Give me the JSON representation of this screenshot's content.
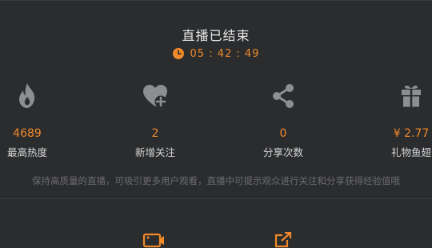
{
  "header": {
    "title": "直播已结束",
    "duration": "05 : 42 : 49"
  },
  "stats": [
    {
      "icon": "flame-icon",
      "value": "4689",
      "label": "最高热度"
    },
    {
      "icon": "heart-plus-icon",
      "value": "2",
      "label": "新增关注"
    },
    {
      "icon": "share-icon",
      "value": "0",
      "label": "分享次数"
    },
    {
      "icon": "gift-icon",
      "value": "¥ 2.77",
      "label": "礼物鱼翅"
    }
  ],
  "hint": "保持高质量的直播，可吸引更多用户观看，直播中可提示观众进行关注和分享获得经验值哦",
  "colors": {
    "background": "#2b2c2e",
    "accent": "#f0892a",
    "icon_gray": "#8d8e91"
  }
}
